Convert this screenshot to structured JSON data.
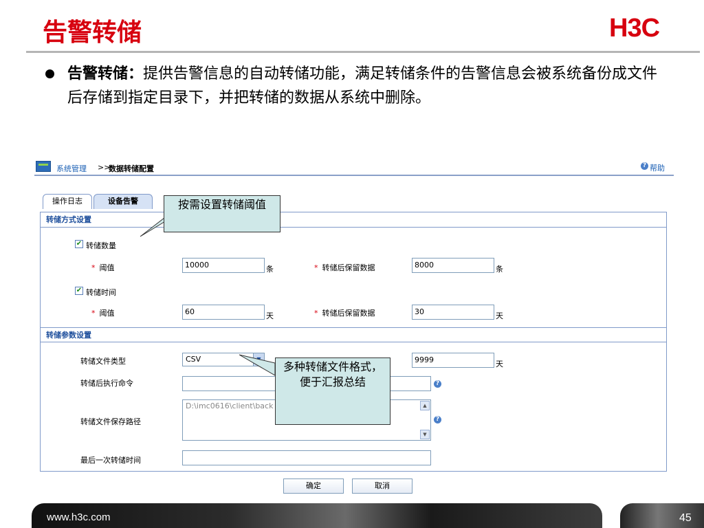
{
  "slide": {
    "title": "告警转储",
    "logo": "H3C",
    "bullet_heading": "告警转储：",
    "bullet_body": "提供告警信息的自动转储功能，满足转储条件的告警信息会被系统备份成文件后存储到指定目录下，并把转储的数据从系统中删除。"
  },
  "app": {
    "breadcrumb_root": "系统管理",
    "breadcrumb_sep": ">>",
    "breadcrumb_current": "数据转储配置",
    "help_label": "帮助",
    "help_icon": "help-icon"
  },
  "tabs": [
    {
      "label": "操作日志",
      "active": false
    },
    {
      "label": "设备告警",
      "active": true
    }
  ],
  "dump_mode": {
    "section_title": "转储方式设置",
    "by_count": {
      "checkbox_label": "转储数量",
      "checked": true,
      "threshold_label": "阈值",
      "threshold_value": "10000",
      "threshold_unit": "条",
      "retain_label": "转储后保留数据",
      "retain_value": "8000",
      "retain_unit": "条"
    },
    "by_time": {
      "checkbox_label": "转储时间",
      "checked": true,
      "threshold_label": "阈值",
      "threshold_value": "60",
      "threshold_unit": "天",
      "retain_label": "转储后保留数据",
      "retain_value": "30",
      "retain_unit": "天"
    }
  },
  "dump_params": {
    "section_title": "转储参数设置",
    "file_type_label": "转储文件类型",
    "file_type_value": "CSV",
    "file_retain_value": "9999",
    "file_retain_unit": "天",
    "post_command_label": "转储后执行命令",
    "post_command_value": "",
    "save_path_label": "转储文件保存路径",
    "save_path_value": "D:\\imc0616\\client\\back",
    "last_dump_label": "最后一次转储时间",
    "last_dump_value": ""
  },
  "buttons": {
    "ok": "确定",
    "cancel": "取消"
  },
  "callouts": {
    "threshold_note": "按需设置转储阈值",
    "format_note": "多种转储文件格式，便于汇报总结"
  },
  "footer": {
    "url": "www.h3c.com",
    "page_number": "45"
  },
  "colors": {
    "brand_red": "#d7000f",
    "link_blue": "#1a5fb4",
    "section_blue": "#1e4f9c",
    "callout_fill": "#cfe8e8"
  }
}
